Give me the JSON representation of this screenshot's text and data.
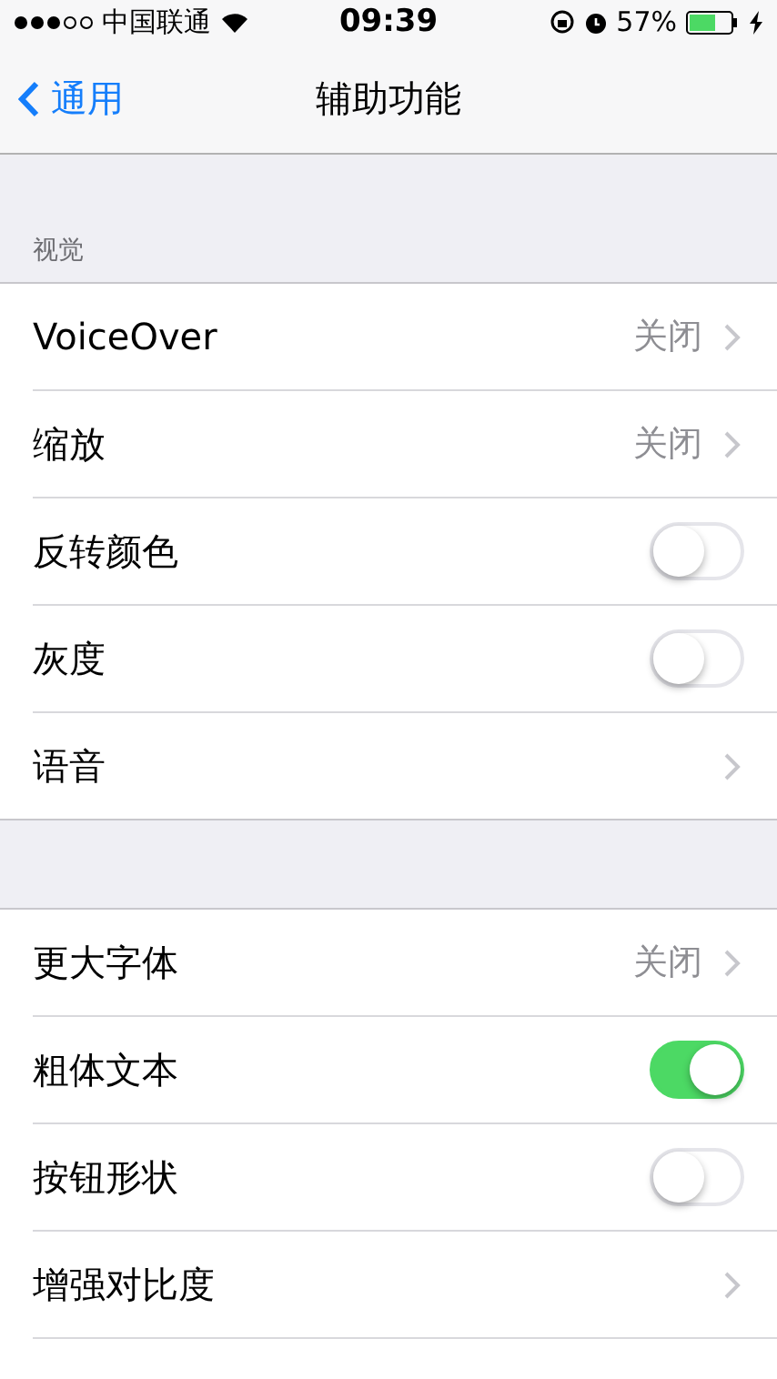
{
  "status_bar": {
    "carrier": "中国联通",
    "time": "09:39",
    "battery_percent": "57%"
  },
  "nav": {
    "back": "通用",
    "title": "辅助功能"
  },
  "sections": [
    {
      "header": "视觉",
      "rows": [
        {
          "kind": "detail",
          "label": "VoiceOver",
          "value": "关闭"
        },
        {
          "kind": "detail",
          "label": "缩放",
          "value": "关闭"
        },
        {
          "kind": "toggle",
          "label": "反转颜色",
          "on": false
        },
        {
          "kind": "toggle",
          "label": "灰度",
          "on": false
        },
        {
          "kind": "link",
          "label": "语音"
        }
      ]
    },
    {
      "rows": [
        {
          "kind": "detail",
          "label": "更大字体",
          "value": "关闭"
        },
        {
          "kind": "toggle",
          "label": "粗体文本",
          "on": true
        },
        {
          "kind": "toggle",
          "label": "按钮形状",
          "on": false
        },
        {
          "kind": "link",
          "label": "增强对比度"
        }
      ]
    }
  ]
}
